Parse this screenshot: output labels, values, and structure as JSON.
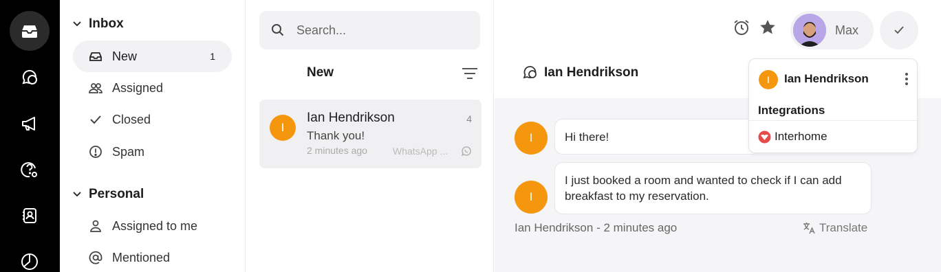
{
  "rail": {
    "items": [
      {
        "name": "inbox"
      },
      {
        "name": "chats"
      },
      {
        "name": "campaigns"
      },
      {
        "name": "help-settings"
      },
      {
        "name": "contacts"
      },
      {
        "name": "reports"
      }
    ]
  },
  "sidebar": {
    "inbox_title": "Inbox",
    "inbox_items": [
      {
        "label": "New",
        "count": "1",
        "icon": "inbox-tray-icon"
      },
      {
        "label": "Assigned",
        "icon": "users-icon"
      },
      {
        "label": "Closed",
        "icon": "check-icon"
      },
      {
        "label": "Spam",
        "icon": "alert-circle-icon"
      }
    ],
    "personal_title": "Personal",
    "personal_items": [
      {
        "label": "Assigned to me",
        "icon": "user-icon"
      },
      {
        "label": "Mentioned",
        "icon": "at-icon"
      }
    ]
  },
  "list": {
    "search_placeholder": "Search...",
    "title": "New",
    "conversations": [
      {
        "initial": "I",
        "name": "Ian Hendrikson",
        "count": "4",
        "message": "Thank you!",
        "time": "2 minutes ago",
        "channel": "WhatsApp ..."
      }
    ]
  },
  "header": {
    "contact_name": "Ian Hendrikson",
    "user_name": "Max"
  },
  "thread": {
    "messages": [
      {
        "initial": "I",
        "text": "Hi there!"
      },
      {
        "initial": "I",
        "text": "I just booked a room and wanted to check if I can add breakfast to my reservation."
      }
    ],
    "meta": "Ian Hendrikson - 2 minutes ago",
    "translate_label": "Translate"
  },
  "popover": {
    "initial": "I",
    "name": "Ian Hendrikson",
    "section_title": "Integrations",
    "integration": "Interhome"
  },
  "colors": {
    "accent_orange": "#f5960f",
    "rail_bg": "#000000",
    "panel_bg": "#f5f5f7"
  }
}
